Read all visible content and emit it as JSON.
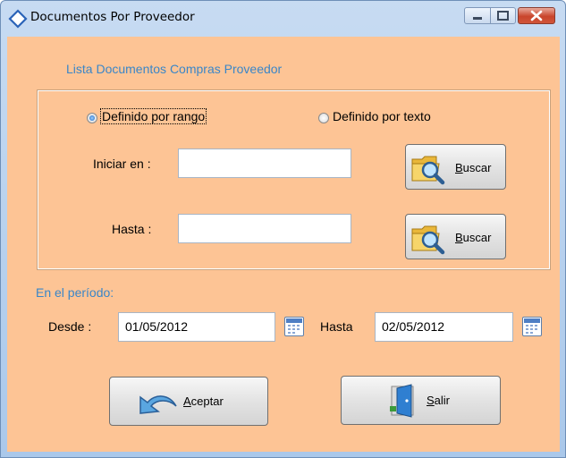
{
  "window": {
    "title": "Documentos Por Proveedor",
    "icon": "diamond-icon"
  },
  "form": {
    "heading": "Lista Documentos Compras Proveedor",
    "mode": {
      "option_range": "Definido por rango",
      "option_text": "Definido por texto",
      "selected": "Definido por rango"
    },
    "range": {
      "start_label": "Iniciar en  :",
      "start_value": "",
      "end_label": "Hasta  :",
      "end_value": "",
      "search_label_mnemonic": "B",
      "search_label_rest": "uscar"
    },
    "period": {
      "label": "En el período:",
      "from_label": "Desde :",
      "from_value": "01/05/2012",
      "to_label": "Hasta",
      "to_value": "02/05/2012"
    },
    "actions": {
      "accept_mnemonic": "A",
      "accept_rest": "ceptar",
      "exit_mnemonic": "S",
      "exit_rest": "alir"
    }
  },
  "colors": {
    "background": "#fdc495",
    "heading": "#3a86c8"
  }
}
